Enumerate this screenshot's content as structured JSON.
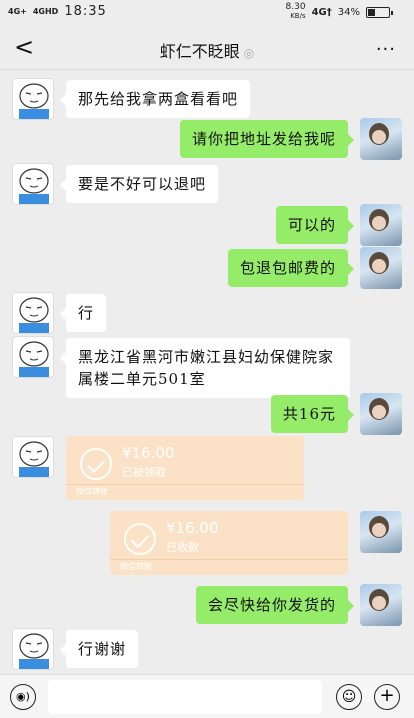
{
  "status_bar": {
    "net1": "4G+",
    "net2": "4GHD",
    "time": "18:35",
    "speed_value": "8.30",
    "speed_unit": "KB/s",
    "net3": "4G†",
    "battery": "34%"
  },
  "nav": {
    "back": "<",
    "title": "虾仁不眨眼",
    "ear_icon": "ear-icon",
    "more": "..."
  },
  "messages": [
    {
      "from": "peer",
      "text": "那先给我拿两盒看看吧"
    },
    {
      "from": "me",
      "text": "请你把地址发给我呢"
    },
    {
      "from": "peer",
      "text": "要是不好可以退吧"
    },
    {
      "from": "me",
      "text": "可以的"
    },
    {
      "from": "me",
      "text": "包退包邮费的"
    },
    {
      "from": "peer",
      "text": "行"
    },
    {
      "from": "peer",
      "text": "黑龙江省黑河市嫩江县妇幼保健院家属楼二单元501室"
    },
    {
      "from": "me",
      "text": "共16元"
    },
    {
      "from": "peer",
      "type": "transfer",
      "amount": "¥16.00",
      "status": "已被领取",
      "footer": "微信转账"
    },
    {
      "from": "me",
      "type": "transfer",
      "amount": "¥16.00",
      "status": "已收款",
      "footer": "微信转账"
    },
    {
      "from": "me",
      "text": "会尽快给你发货的"
    },
    {
      "from": "peer",
      "text": "行谢谢"
    }
  ],
  "input_bar": {
    "voice_icon": "voice-icon",
    "emoji_icon": "emoji-icon",
    "plus_icon": "plus-icon"
  },
  "colors": {
    "me_bubble": "#95ec69",
    "peer_bubble": "#ffffff",
    "transfer_bg": "#fbe2c6",
    "background": "#ededed"
  }
}
